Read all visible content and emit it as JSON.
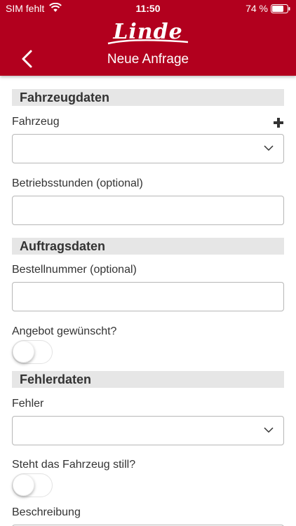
{
  "status_bar": {
    "carrier": "SIM fehlt",
    "time": "11:50",
    "battery": "74 %"
  },
  "header": {
    "logo": "Linde",
    "title": "Neue Anfrage"
  },
  "sections": {
    "vehicle": {
      "title": "Fahrzeugdaten",
      "vehicle_label": "Fahrzeug",
      "hours_label": "Betriebsstunden (optional)"
    },
    "order": {
      "title": "Auftragsdaten",
      "order_number_label": "Bestellnummer (optional)",
      "offer_label": "Angebot gewünscht?"
    },
    "error": {
      "title": "Fehlerdaten",
      "error_label": "Fehler",
      "standstill_label": "Steht das Fahrzeug still?",
      "description_label": "Beschreibung"
    }
  },
  "colors": {
    "brand": "#b2001e",
    "section_bg": "#e6e6e6"
  }
}
